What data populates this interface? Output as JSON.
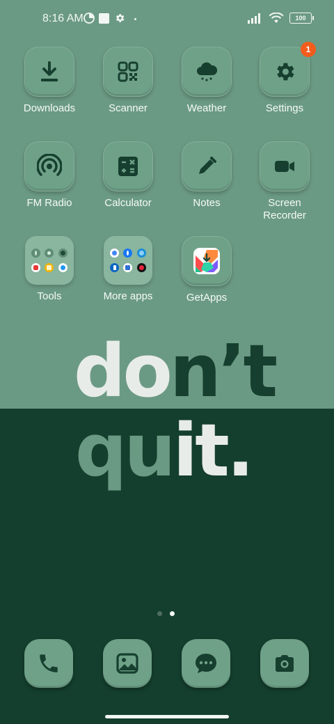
{
  "status": {
    "time": "8:16 AM",
    "battery": "100"
  },
  "apps": [
    {
      "label": "Downloads",
      "icon": "download-icon"
    },
    {
      "label": "Scanner",
      "icon": "qr-scanner-icon"
    },
    {
      "label": "Weather",
      "icon": "weather-icon"
    },
    {
      "label": "Settings",
      "icon": "gear-icon",
      "badge": "1"
    },
    {
      "label": "FM Radio",
      "icon": "radio-icon"
    },
    {
      "label": "Calculator",
      "icon": "calculator-icon"
    },
    {
      "label": "Notes",
      "icon": "pencil-icon"
    },
    {
      "label": "Screen\nRecorder",
      "icon": "video-camera-icon"
    }
  ],
  "folders": [
    {
      "label": "Tools"
    },
    {
      "label": "More apps"
    }
  ],
  "getapps": {
    "label": "GetApps"
  },
  "slogan": {
    "line1a": "do",
    "line1b": "n’t",
    "line2a": "qu",
    "line2b": "it."
  },
  "colors": {
    "background_top": "#6b9a84",
    "background_bottom": "#143f2e",
    "badge": "#f25c1c",
    "icon_glyph": "#163f2f"
  },
  "pages": {
    "total": 2,
    "active": 2
  },
  "dock": [
    {
      "name": "phone",
      "icon": "phone-icon"
    },
    {
      "name": "gallery",
      "icon": "gallery-icon"
    },
    {
      "name": "messages",
      "icon": "message-icon"
    },
    {
      "name": "camera",
      "icon": "camera-icon"
    }
  ]
}
